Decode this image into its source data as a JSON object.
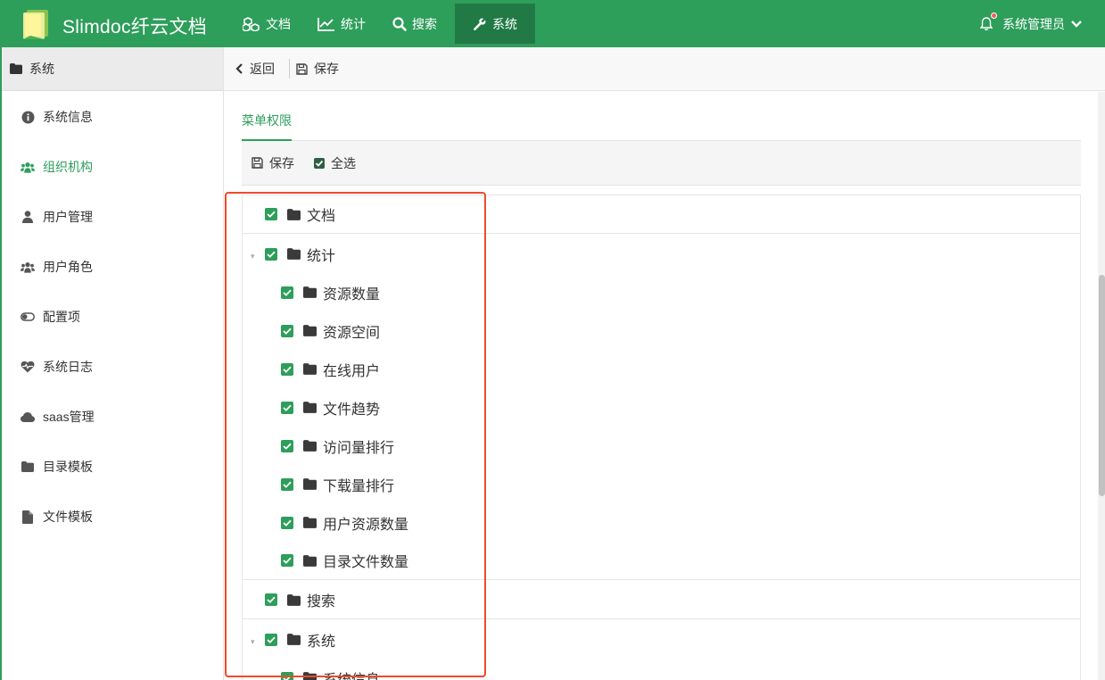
{
  "app": {
    "brand": "Slimdoc纤云文档",
    "nav": [
      {
        "label": "文档",
        "icon": "cubes-icon"
      },
      {
        "label": "统计",
        "icon": "line-chart-icon"
      },
      {
        "label": "搜索",
        "icon": "search-icon"
      },
      {
        "label": "系统",
        "icon": "wrench-icon",
        "active": true
      }
    ],
    "user": "系统管理员",
    "accent": "#2e9e5b"
  },
  "sidebar": {
    "header": "系统",
    "items": [
      {
        "label": "系统信息",
        "icon": "info-circle-icon"
      },
      {
        "label": "组织机构",
        "icon": "users-icon",
        "active": true
      },
      {
        "label": "用户管理",
        "icon": "user-icon"
      },
      {
        "label": "用户角色",
        "icon": "users-icon"
      },
      {
        "label": "配置项",
        "icon": "toggle-icon"
      },
      {
        "label": "系统日志",
        "icon": "heartbeat-icon"
      },
      {
        "label": "saas管理",
        "icon": "cloud-icon"
      },
      {
        "label": "目录模板",
        "icon": "folder-icon"
      },
      {
        "label": "文件模板",
        "icon": "file-icon"
      }
    ]
  },
  "toolbar": {
    "back": "返回",
    "save": "保存"
  },
  "tab": "菜单权限",
  "subbar": {
    "save": "保存",
    "select_all": "全选"
  },
  "tree": [
    {
      "label": "文档",
      "checked": true
    },
    {
      "label": "统计",
      "checked": true,
      "expanded": true,
      "children": [
        {
          "label": "资源数量",
          "checked": true
        },
        {
          "label": "资源空间",
          "checked": true
        },
        {
          "label": "在线用户",
          "checked": true
        },
        {
          "label": "文件趋势",
          "checked": true
        },
        {
          "label": "访问量排行",
          "checked": true
        },
        {
          "label": "下载量排行",
          "checked": true
        },
        {
          "label": "用户资源数量",
          "checked": true
        },
        {
          "label": "目录文件数量",
          "checked": true
        }
      ]
    },
    {
      "label": "搜索",
      "checked": true
    },
    {
      "label": "系统",
      "checked": true,
      "expanded": true,
      "children": [
        {
          "label": "系统信息",
          "checked": true
        }
      ]
    }
  ]
}
